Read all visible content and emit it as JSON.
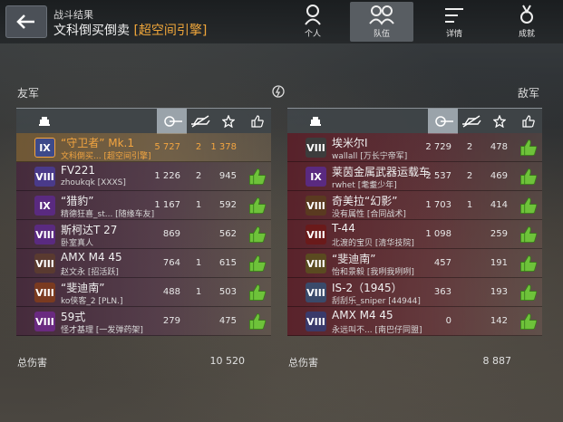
{
  "header": {
    "subtitle": "战斗结果",
    "title_prefix": "文科倒买倒卖 ",
    "title_tag": "[超空间引擎]"
  },
  "tabs": [
    {
      "label": "个人",
      "active": false
    },
    {
      "label": "队伍",
      "active": true
    },
    {
      "label": "详情",
      "active": false
    },
    {
      "label": "成就",
      "active": false
    }
  ],
  "allies": {
    "label": "友军",
    "total_label": "总伤害",
    "total": "10 520",
    "rows": [
      {
        "tank": "“守卫者” Mk.1",
        "player": "文科倒买... [超空间引擎]",
        "damage": "5 727",
        "kills": "2",
        "xp": "1 378",
        "badge": "IX",
        "badge_color": "#3d4a8a",
        "highlight": true
      },
      {
        "tank": "FV221",
        "player": "zhoukqk [XXXS]",
        "damage": "1 226",
        "kills": "2",
        "xp": "945",
        "badge": "VIII",
        "badge_color": "#4a3a8a"
      },
      {
        "tank": "“猎豹”",
        "player": "精德狂喜_st... [随缘车友]",
        "damage": "1 167",
        "kills": "1",
        "xp": "592",
        "badge": "IX",
        "badge_color": "#5a2a80"
      },
      {
        "tank": "斯柯达T 27",
        "player": "卧室真人",
        "damage": "869",
        "kills": "",
        "xp": "562",
        "badge": "VIII",
        "badge_color": "#5a2a80"
      },
      {
        "tank": "AMX M4 45",
        "player": "赵文永 [招活跃]",
        "damage": "764",
        "kills": "1",
        "xp": "615",
        "badge": "VIII",
        "badge_color": "#5a3a30"
      },
      {
        "tank": "“斐迪南”",
        "player": "ko侠客_2 [PLN.]",
        "damage": "488",
        "kills": "1",
        "xp": "503",
        "badge": "VIII",
        "badge_color": "#7a3a20"
      },
      {
        "tank": "59式",
        "player": "怪才基理 [一发弹药架]",
        "damage": "279",
        "kills": "",
        "xp": "475",
        "badge": "VIII",
        "badge_color": "#6a2a80"
      }
    ]
  },
  "enemies": {
    "label": "敌军",
    "total_label": "总伤害",
    "total": "8 887",
    "rows": [
      {
        "tank": "埃米尔I",
        "player": "wallall [万长宁帝军]",
        "damage": "2 729",
        "kills": "2",
        "xp": "478",
        "badge": "VIII",
        "badge_color": "#3c3c3c"
      },
      {
        "tank": "莱茵金属武器运载车",
        "player": "rwhet [耄耋少年]",
        "damage": "2 537",
        "kills": "2",
        "xp": "469",
        "badge": "IX",
        "badge_color": "#5a2a80"
      },
      {
        "tank": "奇美拉“幻影”",
        "player": "没有属性 [合同战术]",
        "damage": "1 703",
        "kills": "1",
        "xp": "414",
        "badge": "VIII",
        "badge_color": "#5a3a20"
      },
      {
        "tank": "T-44",
        "player": "北渡的宝贝 [清华技院]",
        "damage": "1 098",
        "kills": "",
        "xp": "259",
        "badge": "VIII",
        "badge_color": "#6a1a1a"
      },
      {
        "tank": "“斐迪南”",
        "player": "怡和景毅 [我咧我咧咧]",
        "damage": "457",
        "kills": "",
        "xp": "191",
        "badge": "VIII",
        "badge_color": "#5a4a20"
      },
      {
        "tank": "IS-2（1945）",
        "player": "刮刮乐_sniper [44944]",
        "damage": "363",
        "kills": "",
        "xp": "193",
        "badge": "VIII",
        "badge_color": "#3a4a6a"
      },
      {
        "tank": "AMX M4 45",
        "player": "永远叫不... [南巴仔同盟]",
        "damage": "0",
        "kills": "",
        "xp": "142",
        "badge": "VIII",
        "badge_color": "#3a3a6a"
      }
    ]
  },
  "colors": {
    "highlight": "#f3a540",
    "like": "#6ec23a"
  }
}
